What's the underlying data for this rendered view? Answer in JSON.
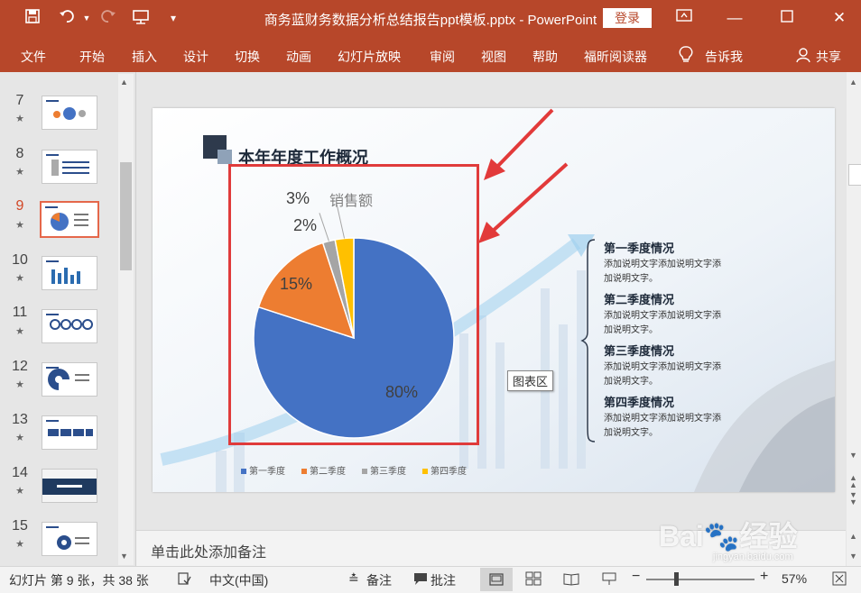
{
  "window": {
    "title": "商务蓝财务数据分析总结报告ppt模板.pptx  -  PowerPoint",
    "login_label": "登录",
    "share_label": "共享"
  },
  "ribbon": {
    "tabs": [
      "文件",
      "开始",
      "插入",
      "设计",
      "切换",
      "动画",
      "幻灯片放映",
      "审阅",
      "视图",
      "帮助",
      "福昕阅读器"
    ],
    "tell_me": "告诉我"
  },
  "slides": [
    {
      "num": "7"
    },
    {
      "num": "8"
    },
    {
      "num": "9",
      "selected": true
    },
    {
      "num": "10"
    },
    {
      "num": "11"
    },
    {
      "num": "12"
    },
    {
      "num": "13"
    },
    {
      "num": "14"
    },
    {
      "num": "15"
    }
  ],
  "slide": {
    "heading": "本年年度工作概况",
    "tooltip": "图表区",
    "quarters": [
      {
        "title": "第一季度情况",
        "line1": "添加说明文字添加说明文字添",
        "line2": "加说明文字。"
      },
      {
        "title": "第二季度情况",
        "line1": "添加说明文字添加说明文字添",
        "line2": "加说明文字。"
      },
      {
        "title": "第三季度情况",
        "line1": "添加说明文字添加说明文字添",
        "line2": "加说明文字。"
      },
      {
        "title": "第四季度情况",
        "line1": "添加说明文字添加说明文字添",
        "line2": "加说明文字。"
      }
    ],
    "colors": {
      "accent": "#b7472a",
      "highlight_box": "#e03b3b",
      "arrow": "#e23a3a"
    }
  },
  "chart_data": {
    "type": "pie",
    "title": "销售额",
    "categories": [
      "第一季度",
      "第二季度",
      "第三季度",
      "第四季度"
    ],
    "values": [
      80,
      15,
      2,
      3
    ],
    "labels": [
      "80%",
      "15%",
      "2%",
      "3%"
    ],
    "colors": [
      "#4472c4",
      "#ed7d31",
      "#a5a5a5",
      "#ffc000"
    ],
    "legend_position": "bottom"
  },
  "notes": {
    "placeholder": "单击此处添加备注"
  },
  "status": {
    "slide_info": "幻灯片 第 9 张，共 38 张",
    "language": "中文(中国)",
    "notes_label": "备注",
    "comments_label": "批注",
    "zoom": "57%"
  },
  "watermark": {
    "site": "jingyan.baidu.com"
  }
}
